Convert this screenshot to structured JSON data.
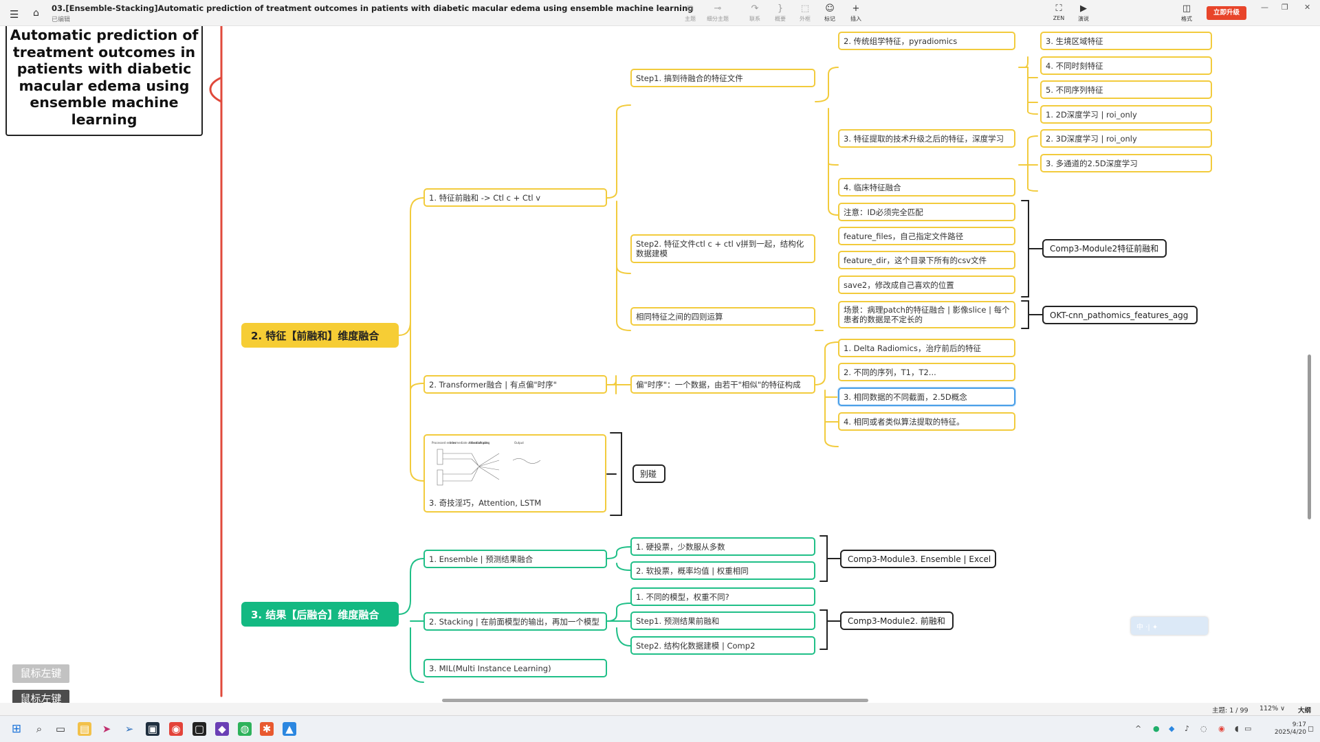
{
  "app": {
    "title": "03.[Ensemble-Stacking]Automatic prediction of treatment outcomes in patients with diabetic macular edema using ensemble machine learning",
    "subtitle": "已编辑",
    "toolbar": [
      {
        "icon": "topic-icon",
        "glyph": "⧉",
        "label": "主题"
      },
      {
        "icon": "subtopic-icon",
        "glyph": "⊸",
        "label": "细分主题"
      },
      {
        "icon": "relation-icon",
        "glyph": "↷",
        "label": "联系"
      },
      {
        "icon": "summary-icon",
        "glyph": "}",
        "label": "概要"
      },
      {
        "icon": "boundary-icon",
        "glyph": "⬚",
        "label": "外框"
      },
      {
        "icon": "marker-icon",
        "glyph": "☺",
        "label": "标记"
      },
      {
        "icon": "insert-icon",
        "glyph": "+",
        "label": "插入"
      }
    ],
    "zen": {
      "glyph": "⛶",
      "label": "ZEN"
    },
    "present": {
      "glyph": "▶",
      "label": "演说"
    },
    "format": {
      "glyph": "◫",
      "label": "格式"
    },
    "upgrade_label": "立即升级"
  },
  "mindmap": {
    "topic_title": "Automatic prediction of treatment outcomes in patients with diabetic macular edema using ensemble machine learning",
    "branch2": {
      "label": "2. 特征【前融和】维度融合",
      "sub1": {
        "label": "1. 特征前融和 -> Ctl c + Ctl v",
        "step1": "Step1. 搞到待融合的特征文件",
        "step1_items": [
          "2. 传统组学特征，pyradiomics",
          "3. 特征提取的技术升级之后的特征，深度学习",
          "4. 临床特征融合"
        ],
        "radiomics_items": [
          "3. 生境区域特征",
          "4. 不同时刻特征",
          "5. 不同序列特征"
        ],
        "deep_items": [
          "1. 2D深度学习 | roi_only",
          "2. 3D深度学习 | roi_only",
          "3. 多通道的2.5D深度学习"
        ],
        "step2": "Step2. 特征文件ctl c + ctl v拼到一起，结构化数据建模",
        "step2_items": [
          "注意：ID必须完全匹配",
          "feature_files，自己指定文件路径",
          "feature_dir，这个目录下所有的csv文件",
          "save2，修改成自己喜欢的位置"
        ],
        "step2_module": "Comp3-Module2特征前融和",
        "arith": "相同特征之间的四则运算",
        "arith_item": "场景：病理patch的特征融合 | 影像slice | 每个患者的数据是不定长的",
        "arith_module": "OKT-cnn_pathomics_features_agg"
      },
      "sub2": {
        "label": "2. Transformer融合 | 有点偏\"时序\"",
        "desc": "偏\"时序\"：一个数据，由若干\"相似\"的特征构成",
        "items": [
          "1. Delta Radiomics，治疗前后的特征",
          "2. 不同的序列，T1，T2...",
          "3. 相同数据的不同截面，2.5D概念",
          "4. 相同或者类似算法提取的特征。"
        ]
      },
      "sub3": {
        "label": "3. 奇技淫巧，Attention, LSTM",
        "figure_headers": [
          "Processed entries",
          "intermediate activation",
          "Attention gate",
          "Pooling",
          "Output"
        ],
        "alias": "别碰"
      }
    },
    "branch3": {
      "label": "3. 结果【后融合】维度融合",
      "ensemble": "1. Ensemble | 预测结果融合",
      "ensemble_items": [
        "1. 硬投票，少数服从多数",
        "2. 软投票，概率均值 | 权重相同"
      ],
      "ensemble_module": "Comp3-Module3. Ensemble | Excel",
      "stacking": "2. Stacking | 在前面模型的输出，再加一个模型",
      "stacking_items": [
        "1. 不同的模型，权重不同?",
        "Step1. 预测结果前融和",
        "Step2. 结构化数据建模 | Comp2"
      ],
      "stacking_module": "Comp3-Module2. 前融和",
      "mil": "3. MIL(Multi Instance Learning)"
    }
  },
  "overlay": {
    "mouse_hint_1": "鼠标左键",
    "mouse_hint_2": "鼠标左键",
    "ime_text": "中 ·| ✦"
  },
  "status": {
    "topics": "主题: 1 / 99",
    "zoom": "112% ∨",
    "outline": "大纲"
  },
  "taskbar": {
    "time": "9:17",
    "date": "2025/4/20"
  },
  "colors": {
    "branch_yellow": "#f6cd35",
    "branch_green": "#13b982",
    "connector_red": "#e0493b",
    "node_yellow_border": "#f2cb3c",
    "node_green_border": "#1fbf87",
    "selection_blue": "#4a9fe8",
    "upgrade_red": "#e8452a"
  }
}
